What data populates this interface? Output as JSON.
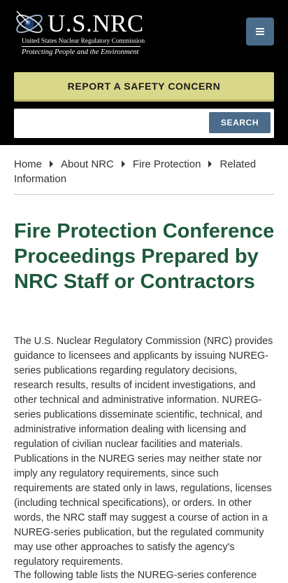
{
  "header": {
    "logo": {
      "name": "U.S.NRC",
      "subtitle": "United States Nuclear Regulatory Commission",
      "tagline": "Protecting People and the Environment"
    },
    "menu_icon": "hamburger-menu-icon",
    "safety_button": "REPORT A SAFETY CONCERN",
    "search": {
      "value": "",
      "placeholder": "",
      "button": "SEARCH"
    }
  },
  "breadcrumb": {
    "items": [
      "Home",
      "About NRC",
      "Fire Protection",
      "Related Information"
    ],
    "separator_icon": "caret-right-icon"
  },
  "page": {
    "title": "Fire Protection Conference Proceedings Prepared by NRC Staff or Contractors",
    "intro": "The U.S. Nuclear Regulatory Commission (NRC) provides guidance to licensees and applicants by issuing NUREG-series publications regarding regulatory decisions, research results, results of incident investigations, and other technical and administrative information. NUREG-series publications disseminate scientific, technical, and administrative information dealing with licensing and regulation of civilian nuclear facilities and materials. Publications in the NUREG series may neither state nor imply any regulatory requirements, since such requirements are stated only in laws, regulations, licenses (including technical specifications), or orders. In other words, the NRC staff may suggest a course of action in a NUREG-series publication, but the regulated community may use other approaches to satisfy the agency's regulatory requirements.",
    "next": "The following table lists the NUREG-series conference"
  },
  "colors": {
    "header_bg": "#000000",
    "safety_bg": "#d9d78a",
    "button_bg": "#4a6b8a",
    "title_green": "#1e5a3c"
  }
}
